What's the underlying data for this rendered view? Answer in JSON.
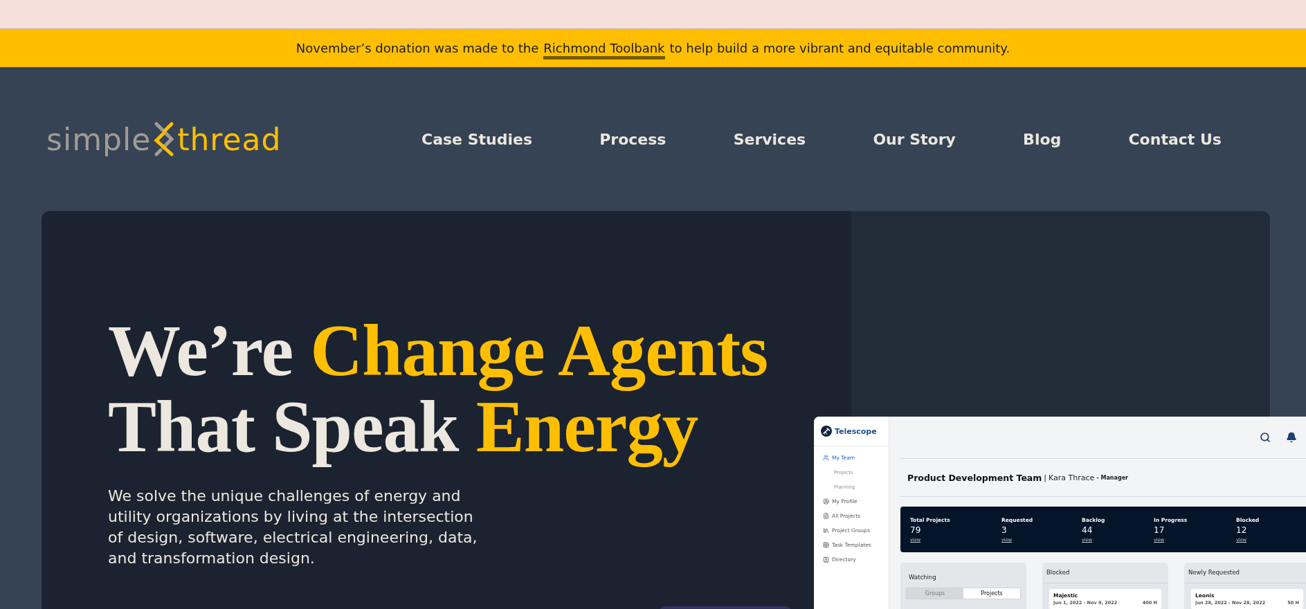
{
  "announcement": {
    "before": "November’s donation was made to the",
    "link": "Richmond Toolbank",
    "after": "to help build a more vibrant and equitable community."
  },
  "logo": {
    "left": "simple",
    "right": "thread"
  },
  "nav": [
    {
      "label": "Case Studies"
    },
    {
      "label": "Process"
    },
    {
      "label": "Services"
    },
    {
      "label": "Our Story"
    },
    {
      "label": "Blog"
    },
    {
      "label": "Contact Us"
    }
  ],
  "hero": {
    "title_lines": [
      [
        {
          "text": "We’re ",
          "highlight": false
        },
        {
          "text": "Change Agents",
          "highlight": true
        }
      ],
      [
        {
          "text": "That Speak ",
          "highlight": false
        },
        {
          "text": "Energy",
          "highlight": true
        }
      ]
    ],
    "body_lines": [
      "We solve the unique challenges of energy and",
      "utility organizations by living at the intersection",
      "of design, software, electrical engineering, data,",
      "and transformation design."
    ]
  },
  "app": {
    "name": "Telescope",
    "sidebar": [
      {
        "label": "My Team",
        "kind": "team",
        "selected": true,
        "children": [
          {
            "label": "Projects",
            "selected": false
          },
          {
            "label": "Planning",
            "selected": false
          }
        ]
      },
      {
        "label": "My Profile",
        "kind": "profile",
        "selected": false
      },
      {
        "label": "All Projects",
        "kind": "projects",
        "selected": false
      },
      {
        "label": "Project Groups",
        "kind": "groups",
        "selected": false
      },
      {
        "label": "Task Templates",
        "kind": "templates",
        "selected": false
      },
      {
        "label": "Directory",
        "kind": "directory",
        "selected": false
      }
    ],
    "team": "Product Development Team",
    "separator": "|",
    "member": "Kara Thrace",
    "role": "- Manager",
    "stats": [
      {
        "label": "Total Projects",
        "value": "79",
        "link": "view"
      },
      {
        "label": "Requested",
        "value": "3",
        "link": "view"
      },
      {
        "label": "Backlog",
        "value": "44",
        "link": "view"
      },
      {
        "label": "In Progress",
        "value": "17",
        "link": "view"
      },
      {
        "label": "Blocked",
        "value": "12",
        "link": "view"
      }
    ],
    "panels": [
      {
        "title": "Watching",
        "kind": "toggle",
        "options": [
          {
            "label": "Groups",
            "selected": false
          },
          {
            "label": "Projects",
            "selected": true
          }
        ]
      },
      {
        "title": "Blocked",
        "kind": "list",
        "items": [
          {
            "name": "Majestic",
            "dates": "Jun 1, 2022 - Nov 9, 2022",
            "hours": "400 H"
          }
        ]
      },
      {
        "title": "Newly Requested",
        "kind": "list",
        "items": [
          {
            "name": "Leonis",
            "dates": "Jun 28, 2022 - Nov 28, 2022",
            "hours": "50 H"
          }
        ]
      }
    ]
  }
}
